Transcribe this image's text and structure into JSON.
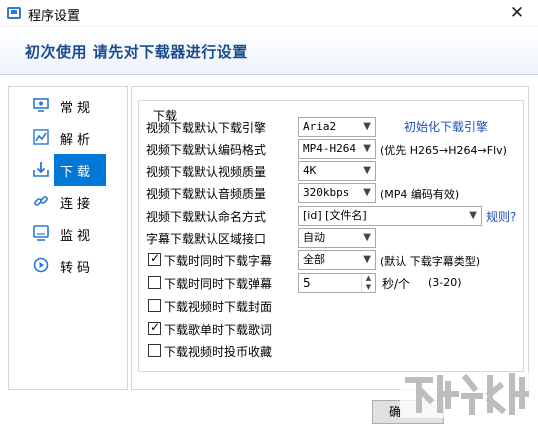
{
  "window": {
    "title": "程序设置",
    "close_glyph": "✕"
  },
  "banner": {
    "text": "初次使用 请先对下载器进行设置"
  },
  "nav": {
    "items": [
      {
        "label": "常规",
        "icon": "monitor-icon"
      },
      {
        "label": "解析",
        "icon": "chart-icon"
      },
      {
        "label": "下载",
        "icon": "download-icon",
        "active": true
      },
      {
        "label": "连接",
        "icon": "link-icon"
      },
      {
        "label": "监视",
        "icon": "screen-icon"
      },
      {
        "label": "转码",
        "icon": "play-icon"
      }
    ]
  },
  "download": {
    "group_title": "下载",
    "engine": {
      "label": "视频下载默认下载引擎",
      "value": "Aria2",
      "link": "初始化下载引擎"
    },
    "format": {
      "label": "视频下载默认编码格式",
      "value": "MP4-H264",
      "note": "(优先 H265→H264→Flv)"
    },
    "quality": {
      "label": "视频下载默认视频质量",
      "value": "4K"
    },
    "audio": {
      "label": "视频下载默认音频质量",
      "value": "320kbps",
      "note": "(MP4 编码有效)"
    },
    "naming": {
      "label": "视频下载默认命名方式",
      "value": "[id] [文件名]",
      "link": "规则?"
    },
    "region": {
      "label": "字幕下载默认区域接口",
      "value": "自动"
    },
    "options": [
      {
        "label": "下载时同时下载字幕",
        "checked": true
      },
      {
        "label": "下载时同时下载弹幕",
        "checked": false
      },
      {
        "label": "下载视频时下载封面",
        "checked": false
      },
      {
        "label": "下载歌单时下载歌词",
        "checked": true
      },
      {
        "label": "下载视频时投币收藏",
        "checked": false
      }
    ],
    "subtitle_type": {
      "value": "全部",
      "note": "(默认 下载字幕类型)"
    },
    "danmaku_interval": {
      "value": "5",
      "unit": "秒/个",
      "range": "(3-20)"
    }
  },
  "footer": {
    "ok_label": "确"
  },
  "colors": {
    "accent": "#0078d7",
    "link": "#1f4fbf",
    "banner_text": "#1a4d8f",
    "watermark": "#bfbfbf"
  }
}
